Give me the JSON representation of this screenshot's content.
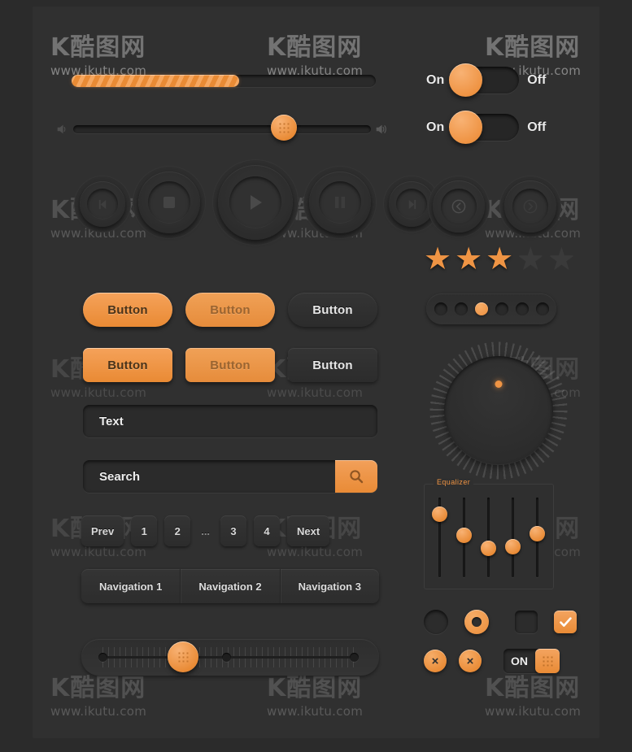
{
  "watermark": {
    "logo": "K酷图网",
    "url": "www.ikutu.com"
  },
  "progress": {
    "value": 55,
    "max": 100
  },
  "volume_slider": {
    "value": 75,
    "left_icon": "speaker-icon",
    "right_icon": "speaker-icon"
  },
  "media_buttons": [
    {
      "name": "prev-button",
      "icon": "previous-icon"
    },
    {
      "name": "stop-button",
      "icon": "stop-icon"
    },
    {
      "name": "play-button",
      "icon": "play-icon"
    },
    {
      "name": "pause-button",
      "icon": "pause-icon"
    },
    {
      "name": "next-button",
      "icon": "next-icon"
    }
  ],
  "buttons": {
    "row1": [
      {
        "label": "Button",
        "state": "default"
      },
      {
        "label": "Button",
        "state": "hover"
      },
      {
        "label": "Button",
        "state": "disabled"
      }
    ],
    "row2": [
      {
        "label": "Button",
        "state": "default"
      },
      {
        "label": "Button",
        "state": "hover"
      },
      {
        "label": "Button",
        "state": "disabled"
      }
    ]
  },
  "text_field": {
    "value": "Text",
    "placeholder": "Text"
  },
  "search_field": {
    "value": "Search",
    "placeholder": "Search",
    "button_icon": "search-icon"
  },
  "pagination": {
    "prev": "Prev",
    "next": "Next",
    "pages": [
      "1",
      "2",
      "...",
      "3",
      "4"
    ]
  },
  "navigation": {
    "items": [
      "Navigation 1",
      "Navigation 2",
      "Navigation 3"
    ]
  },
  "ruler_slider": {
    "value": 33,
    "stops": [
      0,
      50,
      100
    ]
  },
  "toggles": [
    {
      "on_label": "On",
      "off_label": "Off",
      "state": "on"
    },
    {
      "on_label": "On",
      "off_label": "Off",
      "state": "on"
    }
  ],
  "arrow_buttons": [
    {
      "name": "arrow-left-button",
      "icon": "chevron-left-icon"
    },
    {
      "name": "arrow-right-button",
      "icon": "chevron-right-icon"
    }
  ],
  "rating": {
    "value": 3,
    "max": 5
  },
  "dot_pager": {
    "count": 6,
    "active_index": 2
  },
  "dial": {
    "value": 0,
    "indicator": "orange"
  },
  "equalizer": {
    "label": "Equalizer",
    "bands": [
      12,
      42,
      60,
      58,
      40
    ]
  },
  "controls": {
    "radio_off": "radio-unchecked",
    "radio_on": "radio-checked",
    "checkbox_off": "checkbox-unchecked",
    "checkbox_on": "checkbox-checked",
    "close_buttons": [
      "×",
      "×"
    ],
    "on_switch_label": "ON"
  },
  "colors": {
    "accent": "#ee9040",
    "accent_light": "#f6ac67",
    "background": "#2b2b2b",
    "panel": "#303030",
    "text": "#ededed"
  }
}
